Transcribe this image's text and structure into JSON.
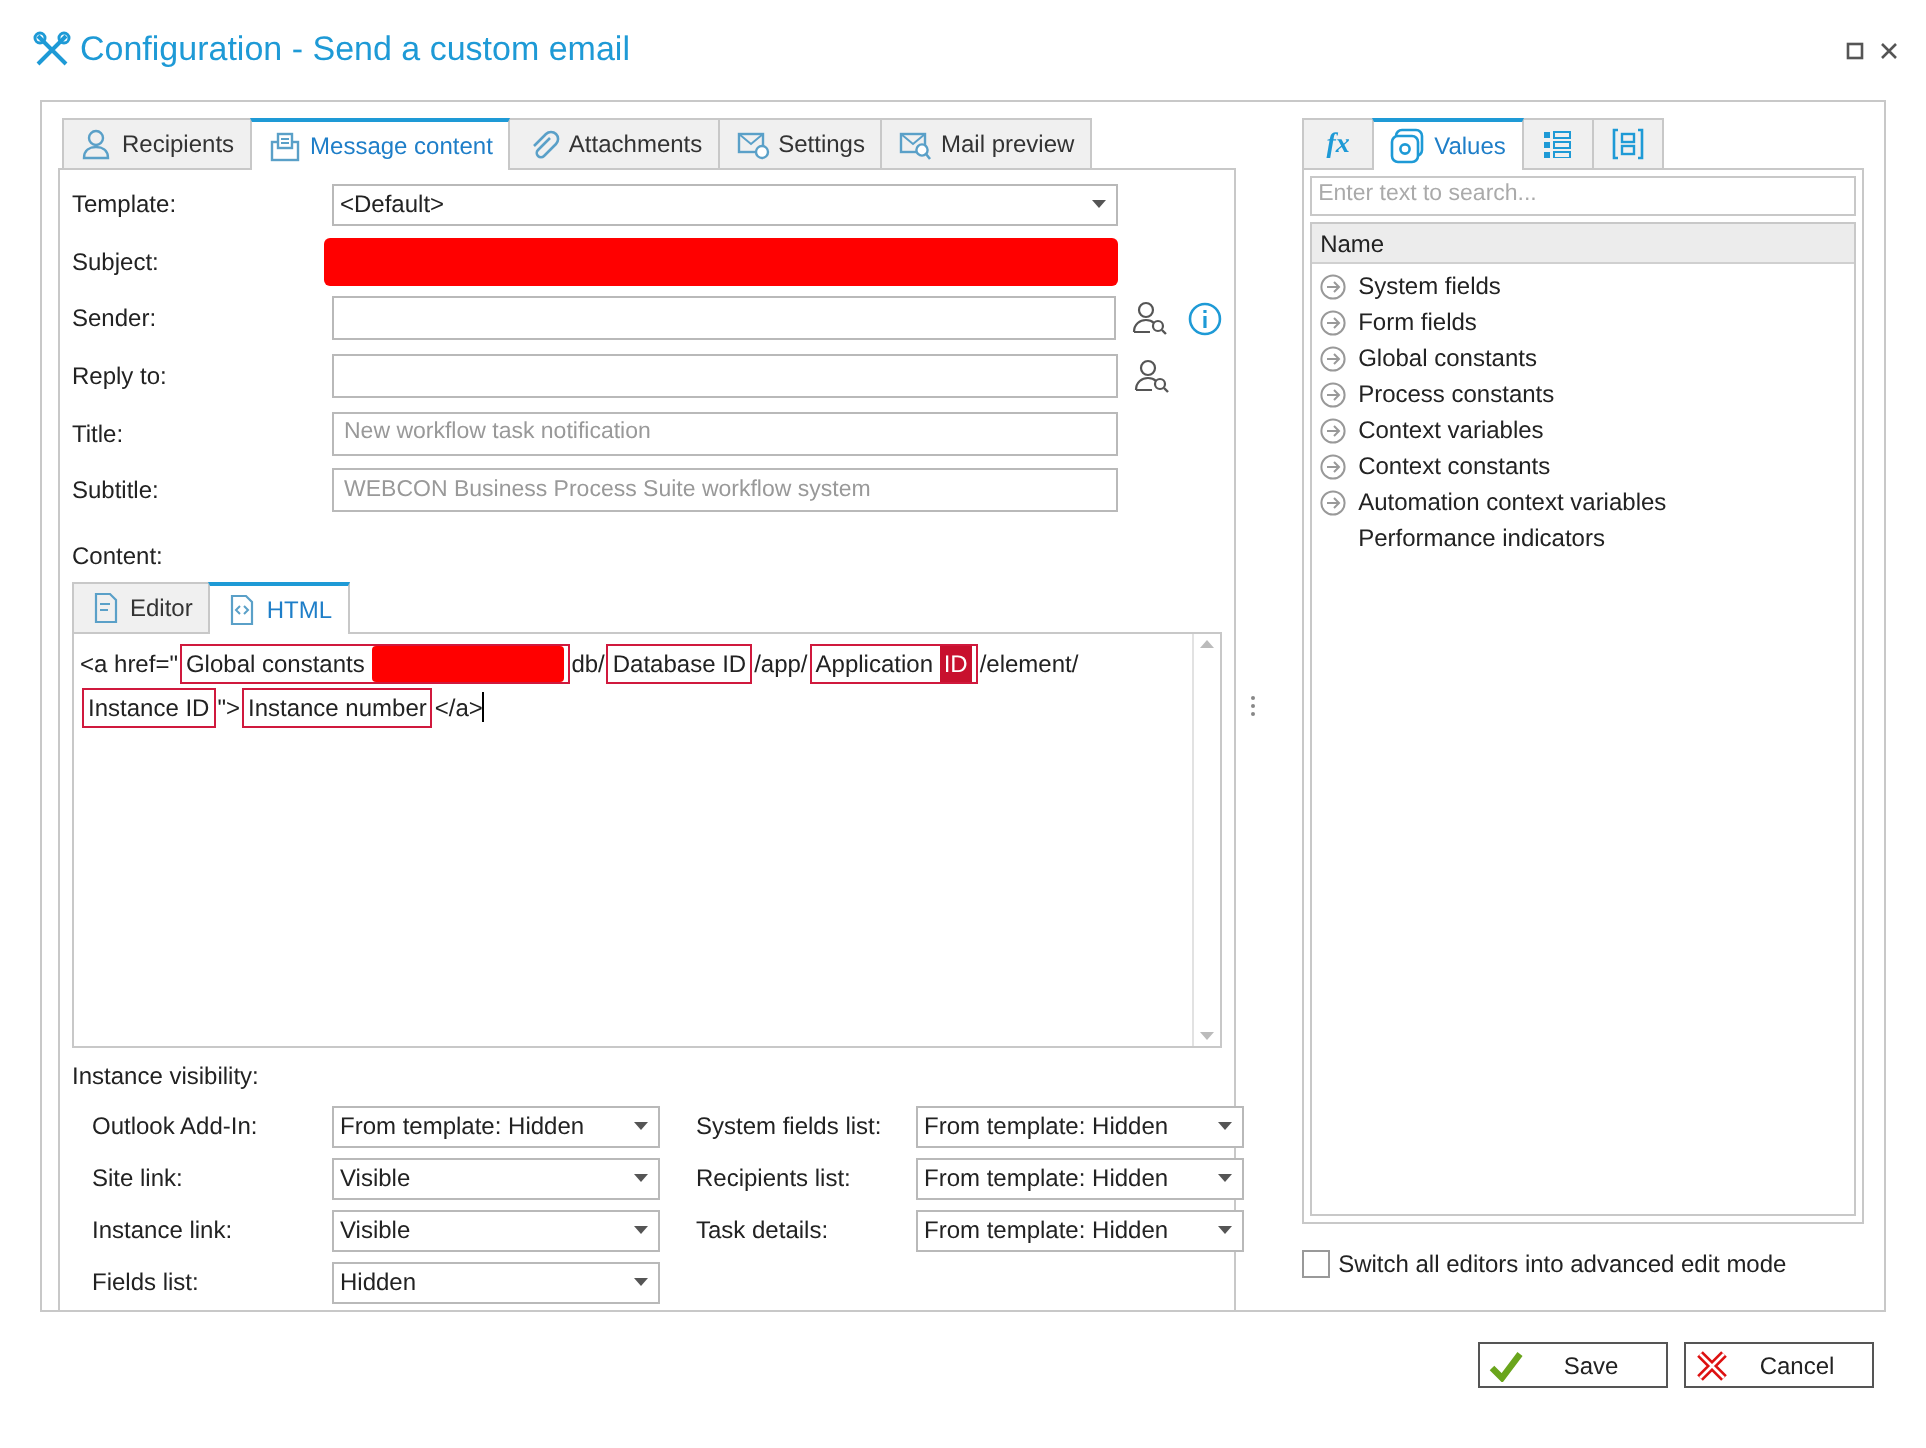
{
  "window": {
    "title": "Configuration - Send a custom email"
  },
  "tabs": [
    {
      "label": "Recipients",
      "selected": false
    },
    {
      "label": "Message content",
      "selected": true
    },
    {
      "label": "Attachments",
      "selected": false
    },
    {
      "label": "Settings",
      "selected": false
    },
    {
      "label": "Mail preview",
      "selected": false
    }
  ],
  "form": [
    {
      "label": "Template:",
      "kind": "dropdown",
      "value": "<Default>"
    },
    {
      "label": "Subject:",
      "kind": "redacted"
    },
    {
      "label": "Sender:",
      "kind": "text",
      "picker": true,
      "info": true
    },
    {
      "label": "Reply to:",
      "kind": "text",
      "picker": true
    },
    {
      "label": "Title:",
      "kind": "text",
      "placeholder": "New workflow task notification"
    },
    {
      "label": "Subtitle:",
      "kind": "text",
      "placeholder": "WEBCON Business Process Suite workflow system"
    }
  ],
  "content": {
    "label": "Content:",
    "tabs": [
      {
        "label": "Editor",
        "selected": false
      },
      {
        "label": "HTML",
        "selected": true
      }
    ],
    "lines": [
      [
        {
          "kind": "text",
          "text": "<a href=\""
        },
        {
          "kind": "token",
          "text": "Global constants ",
          "redacted_tail": true
        },
        {
          "kind": "text",
          "text": "db/"
        },
        {
          "kind": "token",
          "text": "Database ID"
        },
        {
          "kind": "text",
          "text": "/app/"
        },
        {
          "kind": "token",
          "text": "Application ",
          "highlight": "ID"
        },
        {
          "kind": "text",
          "text": "/element/"
        }
      ],
      [
        {
          "kind": "token",
          "text": "Instance ID"
        },
        {
          "kind": "text",
          "text": "\">"
        },
        {
          "kind": "token",
          "text": "Instance number"
        },
        {
          "kind": "text",
          "text": "</a>"
        },
        {
          "kind": "caret"
        }
      ]
    ]
  },
  "visibility": {
    "label": "Instance visibility:",
    "left": [
      {
        "label": "Outlook Add-In:",
        "value": "From template: Hidden"
      },
      {
        "label": "Site link:",
        "value": "Visible"
      },
      {
        "label": "Instance link:",
        "value": "Visible"
      },
      {
        "label": "Fields list:",
        "value": "Hidden"
      }
    ],
    "right": [
      {
        "label": "System fields list:",
        "value": "From template: Hidden"
      },
      {
        "label": "Recipients list:",
        "value": "From template: Hidden"
      },
      {
        "label": "Task details:",
        "value": "From template: Hidden"
      }
    ]
  },
  "side": {
    "tabs": [
      {
        "kind": "fx",
        "label": "fx",
        "selected": false
      },
      {
        "kind": "values",
        "label": "Values",
        "selected": true
      },
      {
        "kind": "list",
        "selected": false
      },
      {
        "kind": "frame",
        "selected": false
      }
    ],
    "search": {
      "placeholder": "Enter text to search..."
    },
    "header": "Name",
    "items": [
      {
        "label": "System fields",
        "expandable": true
      },
      {
        "label": "Form fields",
        "expandable": true
      },
      {
        "label": "Global constants",
        "expandable": true
      },
      {
        "label": "Process constants",
        "expandable": true
      },
      {
        "label": "Context variables",
        "expandable": true
      },
      {
        "label": "Context constants",
        "expandable": true
      },
      {
        "label": "Automation context variables",
        "expandable": true
      },
      {
        "label": "Performance indicators",
        "expandable": false
      }
    ],
    "advanced": {
      "label": "Switch all editors into advanced edit mode",
      "checked": false
    }
  },
  "buttons": [
    {
      "kind": "save",
      "label": "Save"
    },
    {
      "kind": "cancel",
      "label": "Cancel"
    }
  ]
}
